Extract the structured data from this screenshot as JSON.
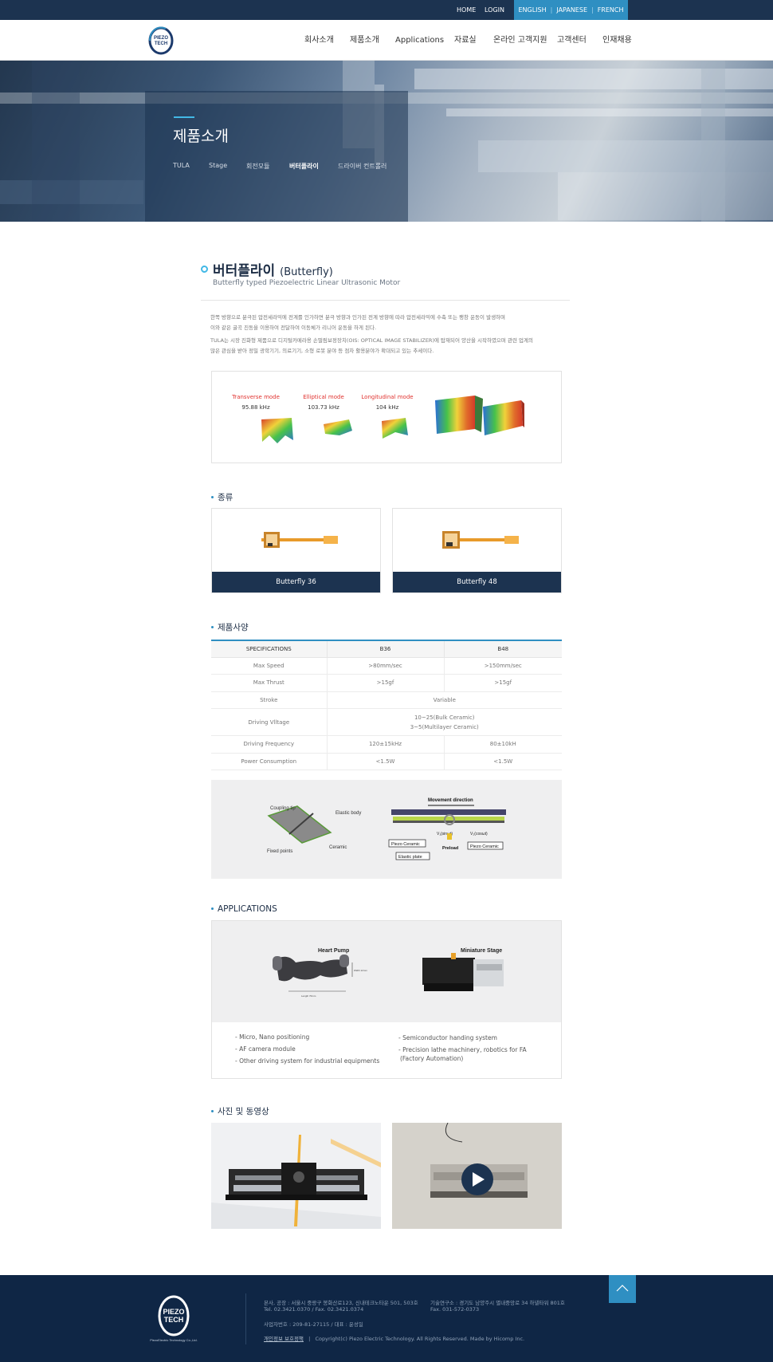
{
  "topbar": {
    "home": "HOME",
    "login": "LOGIN",
    "languages": [
      "ENGLISH",
      "JAPANESE",
      "FRENCH"
    ]
  },
  "header": {
    "logo_text_1": "PIEZO",
    "logo_text_2": "TECH",
    "nav": [
      "회사소개",
      "제품소개",
      "Applications",
      "자료실",
      "온라인 고객지원",
      "고객센터",
      "인재채용"
    ]
  },
  "hero": {
    "title": "제품소개",
    "subnav": [
      "TULA",
      "Stage",
      "회전모듈",
      "버터플라이",
      "드라이버 컨트롤러"
    ],
    "active_subnav": "버터플라이"
  },
  "product": {
    "title_ko": "버터플라이",
    "title_en": "(Butterfly)",
    "subtitle": "Butterfly typed Piezoelectric Linear Ultrasonic Motor",
    "desc_1a": "한쪽 방향으로 분극된 압전세라믹에 전계를 인가하면 분극 방향과 인가된 전계 방향에 따라 압전세라믹에 수축 또는 팽창 운동이 발생하며",
    "desc_1b": "이와 같은 굴곡 진동을 이용하여 전달하여 이동체가 리니어 운동을 하게 된다.",
    "desc_2a": "TULA는 시장 진화형 제품으로 디지털카메라용 손떨림보정장치(OIS: OPTICAL IMAGE STABILIZER)에 탑재되어 양산을 시작하였으며 관련 업계의",
    "desc_2b": "많은 관심을 받아 정밀 광학기기, 의료기기, 소형 로봇 분야 등 점차 활용분야가 확대되고 있는 추세이다."
  },
  "modes": [
    {
      "label": "Transverse mode",
      "freq": "95.88 kHz"
    },
    {
      "label": "Elliptical mode",
      "freq": "103.73 kHz"
    },
    {
      "label": "Longitudinal mode",
      "freq": "104 kHz"
    }
  ],
  "sections": {
    "types": "종류",
    "spec": "제품사양",
    "apps": "APPLICATIONS",
    "media": "사진 및 동영상"
  },
  "types": [
    "Butterfly 36",
    "Butterfly 48"
  ],
  "spec_table": {
    "headers": [
      "SPECIFICATIONS",
      "B36",
      "B48"
    ],
    "max_speed": [
      "Max Speed",
      ">80mm/sec",
      ">150mm/sec"
    ],
    "max_thrust": [
      "Max Thrust",
      ">15gf",
      ">15gf"
    ],
    "stroke": [
      "Stroke",
      "Variable"
    ],
    "driving_voltage": [
      "Driving Vlltage",
      "10~25(Bulk Ceramic)",
      "3~5(Multilayer Ceramic)"
    ],
    "driving_frequency": [
      "Driving Frequency",
      "120±15kHz",
      "80±10kH"
    ],
    "power": [
      "Power Consumption",
      "<1.5W",
      "<1.5W"
    ]
  },
  "diagram": {
    "coupling_tip": "Coupling tip",
    "elastic_body": "Elastic body",
    "fixed_points": "Fixed points",
    "ceramic": "Ceramic",
    "movement_direction": "Movement direction",
    "v1": "V₁(sinωt)",
    "v2": "V₂(cosωt)",
    "piezo_ceramic": "Piezo Ceramic",
    "preload": "Preload",
    "elastic_plate": "Elastic plate"
  },
  "applications": {
    "heart_pump": "Heart Pump",
    "miniature_stage": "Miniature Stage",
    "length_label": "Length 70mm",
    "width_label": "Width 12mm",
    "left_items": [
      "- Micro, Nano positioning",
      "- AF camera module",
      "- Other driving system for industrial equipments"
    ],
    "right_item_1": "- Semiconductor handing system",
    "right_item_2a": "- Precision lathe machinery, robotics for FA",
    "right_item_2b": "(Factory Automation)"
  },
  "footer": {
    "logo_text_1": "PIEZO",
    "logo_text_2": "TECH",
    "logo_caption": "PiezoElectric Technology Co.,Ltd.",
    "address": "본사, 공장 : 서울시 중랑구 봉화산로123, 신내테크노타운 501, 503호",
    "tel": "Tel. 02.3421.0370  /  Fax. 02.3421.0374",
    "lab": "기술연구소 : 경기도 남양주시 별내중앙로 34 하넬타워 801호",
    "lab_fax": "Fax. 031-572-0373",
    "biz": "사업자번호 :  209-81-27115  /  대표 : 윤성일",
    "privacy": "개인정보 보호정책",
    "copyright": "Copyright(c) Piezo Electric Technology. All Rights Reserved. Made by Hicomp Inc."
  },
  "colors": {
    "navy": "#1c3350",
    "accent_blue": "#2f8fc2",
    "light_blue": "#42b8e6",
    "mode_red": "#e0322f"
  }
}
